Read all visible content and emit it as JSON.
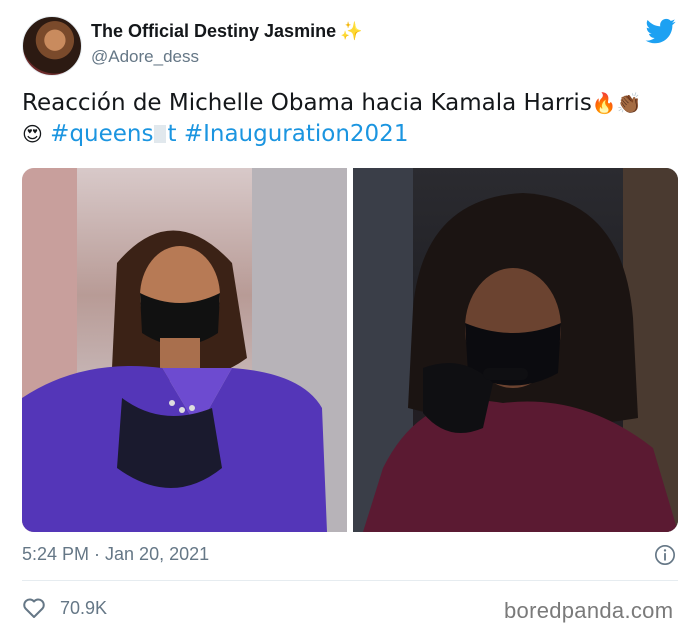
{
  "author": {
    "display_name": "The Official Destiny Jasmine",
    "name_emoji": "✨",
    "handle": "@Adore_dess"
  },
  "tweet": {
    "text_main": "Reacción de Michelle Obama hacia Kamala Harris",
    "text_emojis_1": "🔥👏🏾",
    "text_emoji_2": "😍",
    "hashtag_1_prefix": "#queens",
    "hashtag_1_suffix": "t",
    "hashtag_2": "#Inauguration2021"
  },
  "timestamp": "5:24 PM · Jan 20, 2021",
  "likes": "70.9K",
  "watermark": "boredpanda.com",
  "icons": {
    "platform": "twitter-bird-icon",
    "info": "info-icon",
    "like": "heart-icon"
  },
  "colors": {
    "twitter_blue": "#1da1f2",
    "hashtag": "#1b95e0",
    "muted": "#657786",
    "text": "#14171a"
  }
}
